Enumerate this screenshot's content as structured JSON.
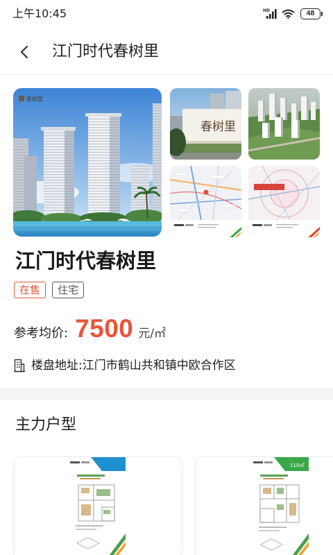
{
  "status_bar": {
    "time": "上午10:45",
    "network_label": "HD",
    "signal_icon": "signal-bars-icon",
    "wifi_icon": "wifi-icon",
    "battery_icon": "battery-icon",
    "battery_level": "48"
  },
  "header": {
    "back_icon": "chevron-left-icon",
    "title": "江门时代春树里"
  },
  "gallery": {
    "main_logo_text": "春树里",
    "sign_text": "春树里"
  },
  "project": {
    "name": "江门时代春树里",
    "tags": [
      {
        "label": "在售",
        "color": "#e4573a"
      },
      {
        "label": "住宅",
        "color": "#5a5a5a"
      }
    ],
    "price_label": "参考均价:",
    "price_value": "7500",
    "price_unit": "元/㎡",
    "price_color": "#e9553a",
    "address_icon": "building-icon",
    "address_label": "楼盘地址:",
    "address": "江门市鹤山共和镇中欧合作区"
  },
  "floor_plans": {
    "heading": "主力户型",
    "cards": [
      {
        "badge_color": "#1f8fd0"
      },
      {
        "badge_color": "#3aa84a",
        "badge_text": "119㎡"
      }
    ]
  }
}
